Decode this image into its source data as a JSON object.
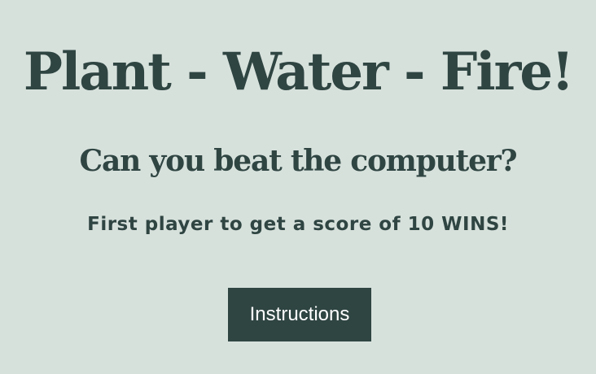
{
  "title": "Plant - Water - Fire!",
  "subtitle": "Can you beat the computer?",
  "rule_text": "First player to get a score of 10 WINS!",
  "instructions_button_label": "Instructions",
  "colors": {
    "background": "#d7e1dc",
    "text": "#2f4542",
    "button_bg": "#2f4542",
    "button_text": "#ffffff"
  }
}
